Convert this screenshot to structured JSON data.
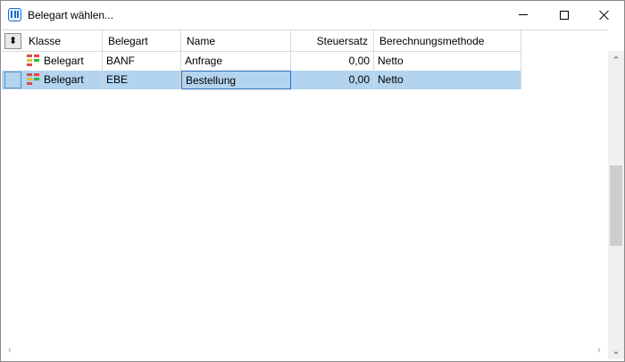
{
  "window": {
    "title": "Belegart wählen..."
  },
  "icons": {
    "app": "app-window-icon",
    "minimize": "minimize-icon",
    "maximize": "maximize-icon",
    "close": "close-icon",
    "sort": "sort-updown-icon",
    "klasse": "belegart-class-icon"
  },
  "table": {
    "sort_glyph": "⬍",
    "columns": [
      "Klasse",
      "Belegart",
      "Name",
      "Steuersatz",
      "Berechnungsmethode"
    ],
    "rows": [
      {
        "klasse": "Belegart",
        "belegart": "BANF",
        "name": "Anfrage",
        "steuersatz": "0,00",
        "methode": "Netto",
        "selected": false
      },
      {
        "klasse": "Belegart",
        "belegart": "EBE",
        "name": "Bestellung",
        "steuersatz": "0,00",
        "methode": "Netto",
        "selected": true
      }
    ]
  },
  "scrollbar": {
    "up_glyph": "⌃",
    "down_glyph": "⌄",
    "left_glyph": "‹",
    "right_glyph": "›"
  },
  "colors": {
    "selection": "#b3d4ef",
    "accent": "#1f6fd1"
  }
}
